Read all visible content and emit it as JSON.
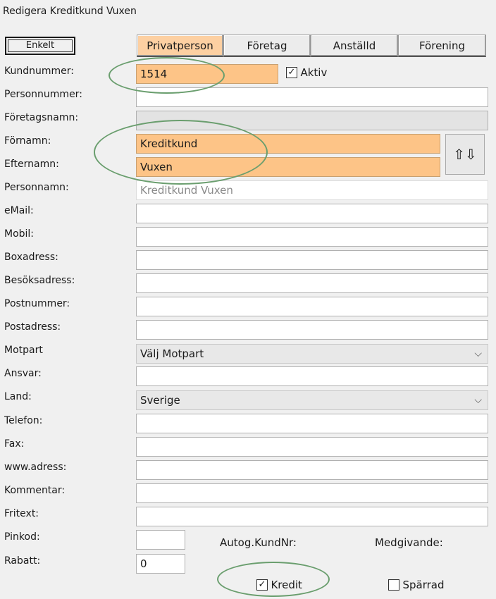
{
  "window": {
    "title": "Redigera Kreditkund Vuxen"
  },
  "mode_button": "Enkelt",
  "tabs": [
    "Privatperson",
    "Företag",
    "Anställd",
    "Förening"
  ],
  "aktiv": {
    "label": "Aktiv",
    "checked": true
  },
  "fields": {
    "kundnummer": {
      "label": "Kundnummer:",
      "value": "1514"
    },
    "personnummer": {
      "label": "Personnummer:",
      "value": ""
    },
    "foretagsnamn": {
      "label": "Företagsnamn:",
      "value": ""
    },
    "fornamn": {
      "label": "Förnamn:",
      "value": "Kreditkund"
    },
    "efternamn": {
      "label": "Efternamn:",
      "value": "Vuxen"
    },
    "personnamn": {
      "label": "Personnamn:",
      "value": "Kreditkund Vuxen"
    },
    "email": {
      "label": "eMail:",
      "value": ""
    },
    "mobil": {
      "label": "Mobil:",
      "value": ""
    },
    "boxadress": {
      "label": "Boxadress:",
      "value": ""
    },
    "besoksadress": {
      "label": "Besöksadress:",
      "value": ""
    },
    "postnummer": {
      "label": "Postnummer:",
      "value": ""
    },
    "postadress": {
      "label": "Postadress:",
      "value": ""
    },
    "motpart": {
      "label": "Motpart",
      "value": "Välj Motpart"
    },
    "ansvar": {
      "label": "Ansvar:",
      "value": ""
    },
    "land": {
      "label": "Land:",
      "value": "Sverige"
    },
    "telefon": {
      "label": "Telefon:",
      "value": ""
    },
    "fax": {
      "label": "Fax:",
      "value": ""
    },
    "www": {
      "label": "www.adress:",
      "value": ""
    },
    "kommentar": {
      "label": "Kommentar:",
      "value": ""
    },
    "fritext": {
      "label": "Fritext:",
      "value": ""
    },
    "pinkod": {
      "label": "Pinkod:",
      "value": ""
    },
    "rabatt": {
      "label": "Rabatt:",
      "value": "0"
    }
  },
  "autog_kundnr": "Autog.KundNr:",
  "medgivande": "Medgivande:",
  "kredit": {
    "label": "Kredit",
    "checked": true
  },
  "sparrad": {
    "label": "Spärrad",
    "checked": false
  },
  "icons": {
    "swap": "swap-up-down-icon",
    "dropdown": "chevron-down-icon"
  },
  "colors": {
    "highlight_field": "#fdc487",
    "active_tab": "#fdd0a2",
    "annotation": "#6a9e6e"
  }
}
